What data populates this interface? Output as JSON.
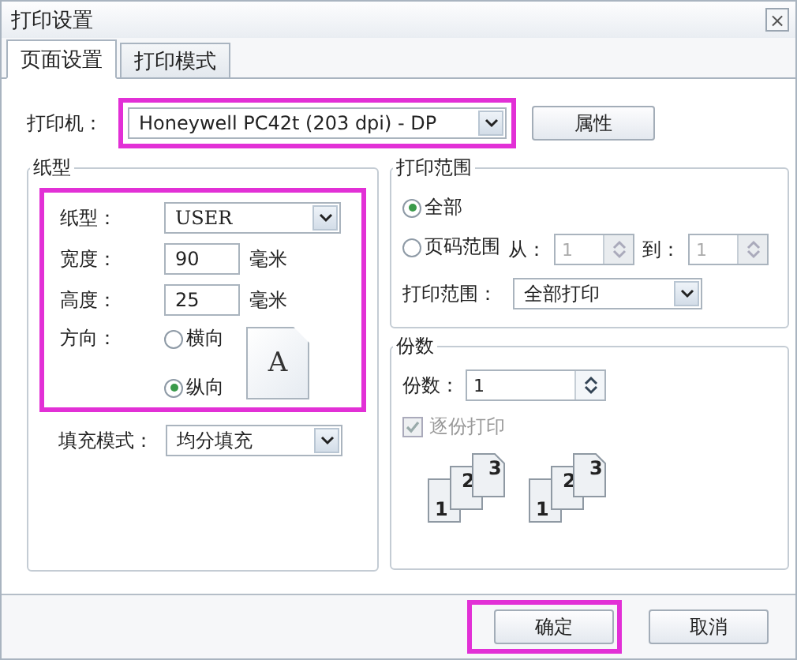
{
  "window": {
    "title": "打印设置",
    "close": "×"
  },
  "tabs": [
    {
      "label": "页面设置",
      "selected": true
    },
    {
      "label": "打印模式",
      "selected": false
    }
  ],
  "printer": {
    "label": "打印机：",
    "value": "Honeywell PC42t (203 dpi) - DP",
    "highlighted": true,
    "properties_button": "属性"
  },
  "paper": {
    "title": "纸型",
    "highlighted": true,
    "type": {
      "label": "纸型：",
      "value": "USER"
    },
    "width": {
      "label": "宽度：",
      "value": "90",
      "unit": "毫米"
    },
    "height": {
      "label": "高度：",
      "value": "25",
      "unit": "毫米"
    },
    "orientation": {
      "label": "方向：",
      "preview": "A",
      "options": [
        {
          "label": "横向",
          "selected": false
        },
        {
          "label": "纵向",
          "selected": true
        }
      ]
    },
    "fill_mode": {
      "label": "填充模式：",
      "value": "均分填充"
    }
  },
  "print_range": {
    "title": "打印范围",
    "options": [
      {
        "label": "全部",
        "selected": true
      },
      {
        "label": "页码范围",
        "selected": false
      }
    ],
    "from": {
      "label": "从：",
      "value": "1",
      "disabled": true
    },
    "to": {
      "label": "到：",
      "value": "1",
      "disabled": true
    },
    "range": {
      "label": "打印范围：",
      "value": "全部打印"
    }
  },
  "copies": {
    "title": "份数",
    "count": {
      "label": "份数：",
      "value": "1"
    },
    "collate": {
      "label": "逐份打印",
      "checked": true,
      "disabled": true
    },
    "collate_pages": [
      [
        "1",
        "2",
        "3"
      ],
      [
        "1",
        "2",
        "3"
      ]
    ]
  },
  "buttons": [
    {
      "label": "确定",
      "highlighted": true
    },
    {
      "label": "取消",
      "highlighted": false
    }
  ]
}
